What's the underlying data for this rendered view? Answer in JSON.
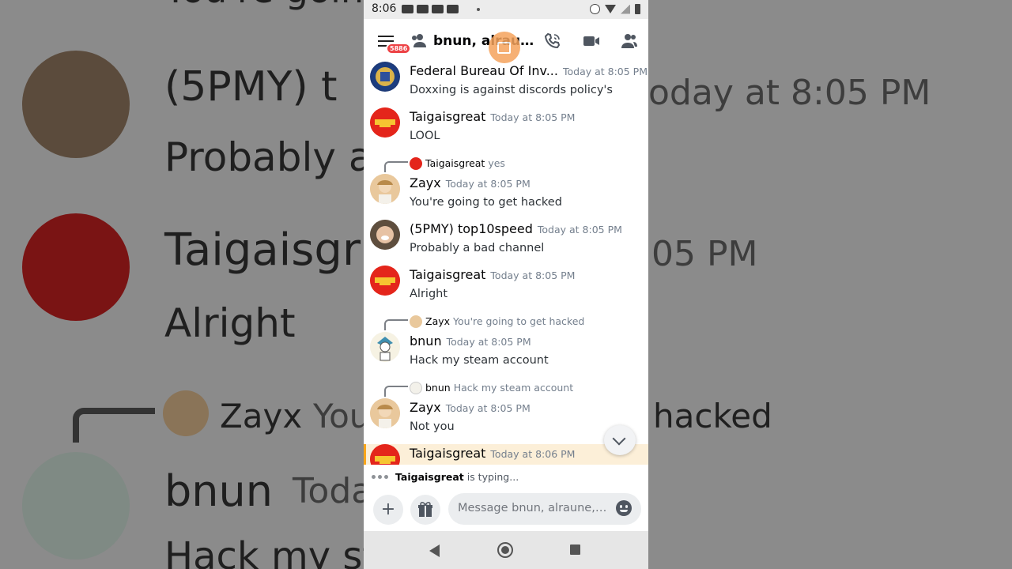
{
  "status_bar": {
    "time": "8:06"
  },
  "header": {
    "title": "bnun, alraun...",
    "badge": "5886"
  },
  "messages": [
    {
      "author": "Federal Bureau Of Inv...",
      "time": "Today at 8:05 PM",
      "text": "Doxxing is against discords policy's"
    },
    {
      "author": "Taigaisgreat",
      "time": "Today at 8:05 PM",
      "text": "LOOL"
    },
    {
      "reply_to": {
        "author": "Taigaisgreat",
        "text": "yes"
      },
      "author": "Zayx",
      "time": "Today at 8:05 PM",
      "text": "You're going to get hacked"
    },
    {
      "author": "(5PMY) top10speed",
      "time": "Today at 8:05 PM",
      "text": "Probably a bad channel"
    },
    {
      "author": "Taigaisgreat",
      "time": "Today at 8:05 PM",
      "text": "Alright"
    },
    {
      "reply_to": {
        "author": "Zayx",
        "text": "You're going to get hacked"
      },
      "author": "bnun",
      "time": "Today at 8:05 PM",
      "text": "Hack my steam account"
    },
    {
      "reply_to": {
        "author": "bnun",
        "text": "Hack my steam account"
      },
      "author": "Zayx",
      "time": "Today at 8:05 PM",
      "text": "Not you"
    },
    {
      "author": "Taigaisgreat",
      "time": "Today at 8:06 PM",
      "text": ""
    }
  ],
  "typing": {
    "user": "Taigaisgreat",
    "suffix": " is typing..."
  },
  "composer": {
    "placeholder": "Message bnun, alraune, A...",
    "plus": "+"
  },
  "background": {
    "lines": [
      "You're goin",
      "(5PMY) t",
      "Probably a",
      "Taigaisgr",
      "Alright",
      "Zayx",
      "You",
      "hacked",
      "bnun",
      "Toda",
      "Hack my st",
      "oday at 8:05 PM",
      "05 PM"
    ]
  },
  "colors": {
    "accent": "#faa61a",
    "badge": "#ed4245",
    "highlight": "#fcefd8"
  }
}
